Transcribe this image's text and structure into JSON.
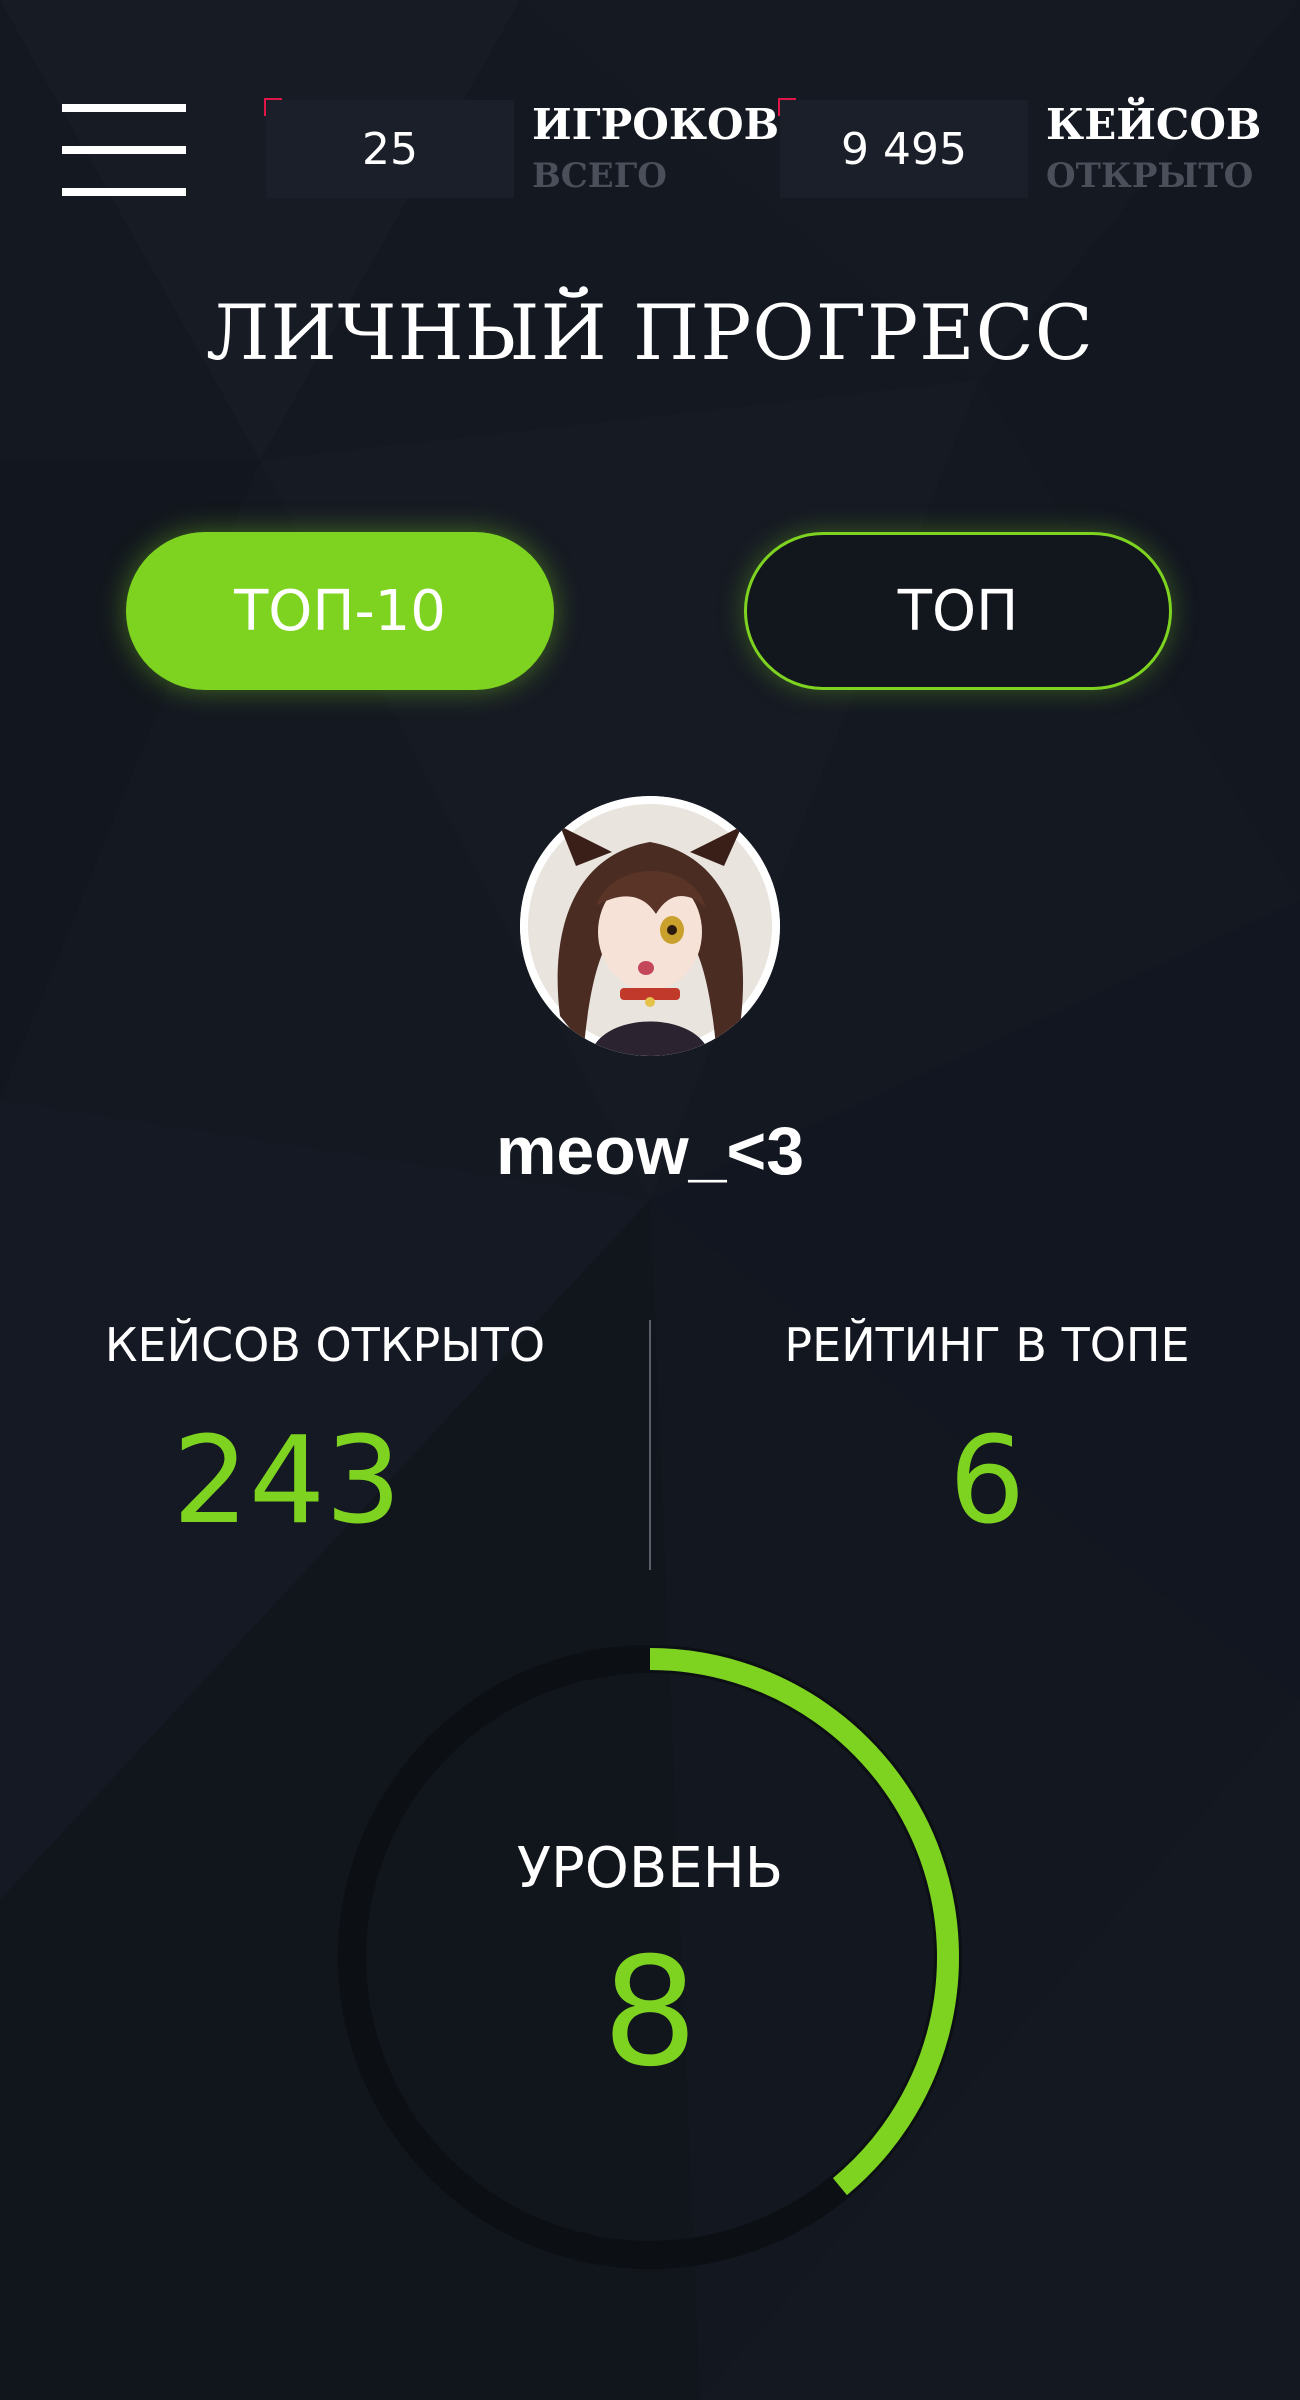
{
  "header": {
    "players": {
      "value": "25",
      "title": "ИГРОКОВ",
      "subtitle": "ВСЕГО"
    },
    "cases": {
      "value": "9 495",
      "title": "КЕЙСОВ",
      "subtitle": "ОТКРЫТО"
    }
  },
  "page_title": "ЛИЧНЫЙ ПРОГРЕСС",
  "tabs": [
    {
      "label": "ТОП-10",
      "active": true
    },
    {
      "label": "ТОП",
      "active": false
    }
  ],
  "profile": {
    "username": "meow_<3"
  },
  "stats": {
    "cases_opened": {
      "label": "КЕЙСОВ ОТКРЫТО",
      "value": "243"
    },
    "rating": {
      "label": "РЕЙТИНГ В ТОПЕ",
      "value": "6"
    }
  },
  "level": {
    "label": "УРОВЕНЬ",
    "value": "8",
    "progress_fraction": 0.39
  },
  "colors": {
    "accent": "#7ed321",
    "background": "#141821",
    "counter_box": "#1b1f29",
    "pixel_marker": "#e01646",
    "muted_text": "#4a4f5a"
  },
  "icons": {
    "menu": "hamburger-menu-icon",
    "marker": "pixel-corner-marker"
  }
}
